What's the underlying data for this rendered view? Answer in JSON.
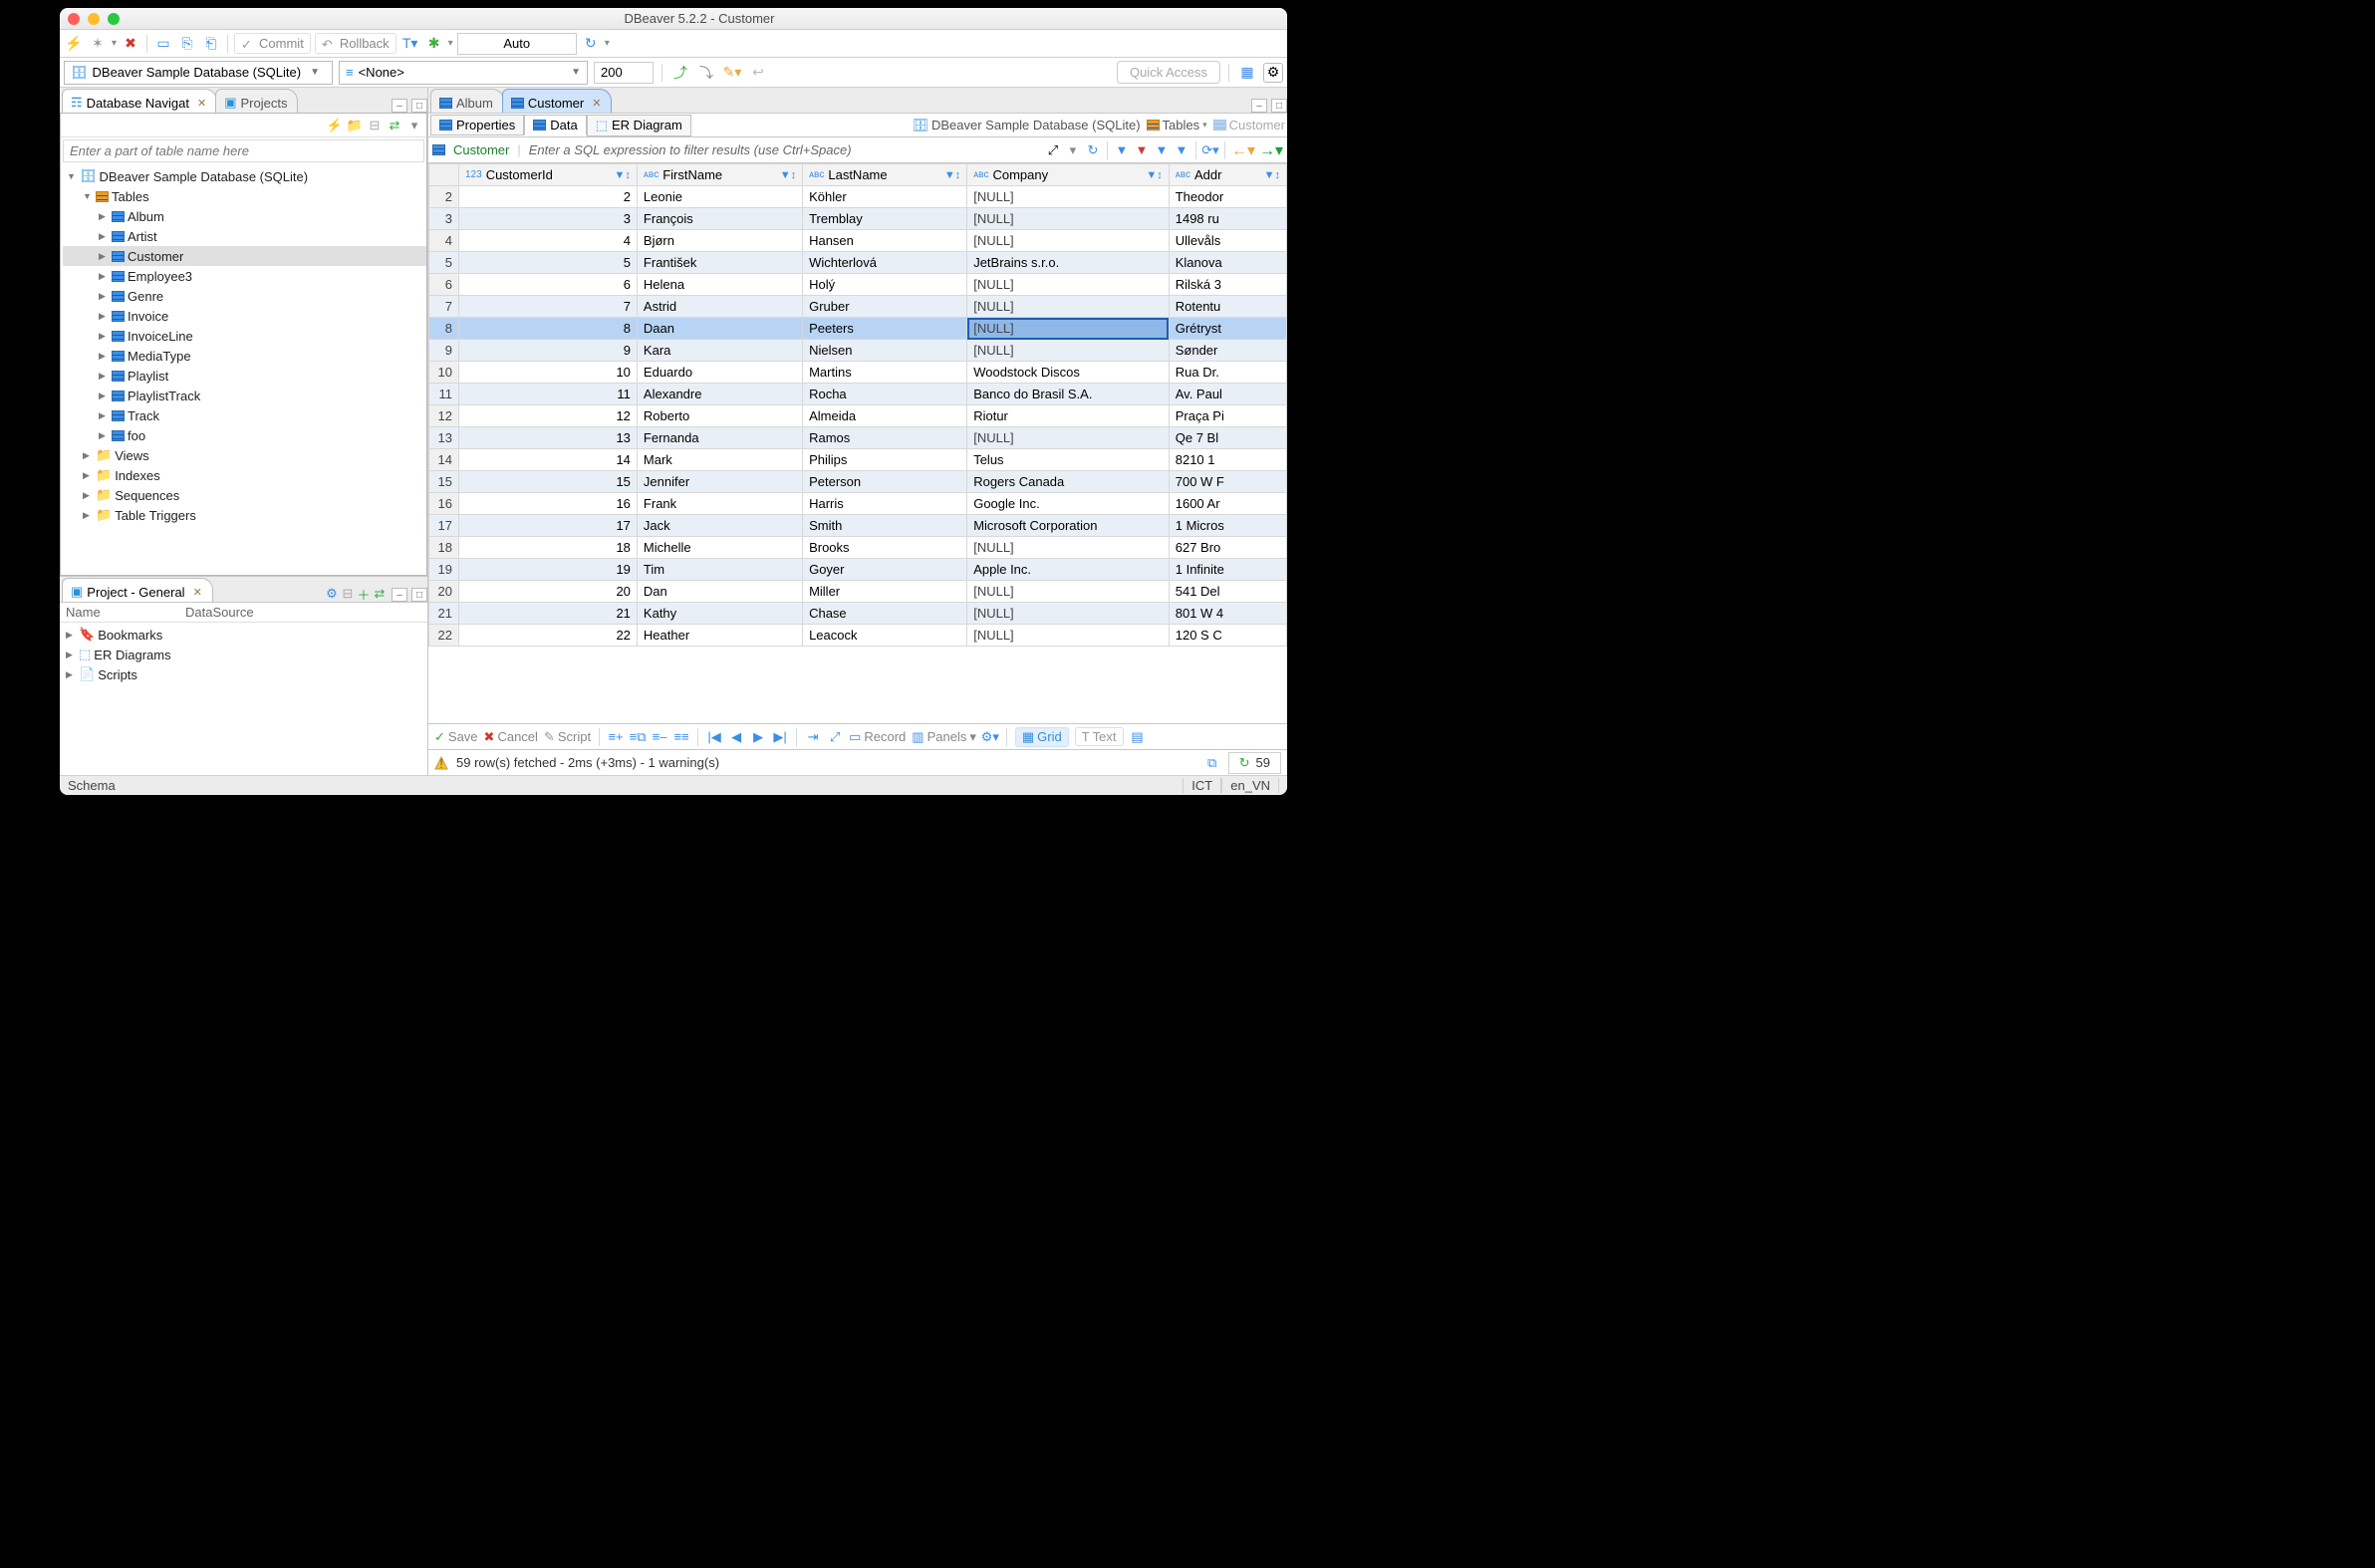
{
  "window": {
    "title": "DBeaver 5.2.2 - Customer"
  },
  "toolbar": {
    "commit": "Commit",
    "rollback": "Rollback",
    "txmode": "Auto"
  },
  "datasource": {
    "combo": "DBeaver Sample Database (SQLite)",
    "schema": "<None>",
    "limit": "200",
    "quick_access": "Quick Access"
  },
  "left": {
    "tabs": {
      "nav": "Database Navigat",
      "projects": "Projects"
    },
    "filter_placeholder": "Enter a part of table name here",
    "root": "DBeaver Sample Database (SQLite)",
    "tables_label": "Tables",
    "tables": [
      "Album",
      "Artist",
      "Customer",
      "Employee3",
      "Genre",
      "Invoice",
      "InvoiceLine",
      "MediaType",
      "Playlist",
      "PlaylistTrack",
      "Track",
      "foo"
    ],
    "folders": [
      "Views",
      "Indexes",
      "Sequences",
      "Table Triggers"
    ],
    "selected_table": "Customer"
  },
  "project": {
    "title": "Project - General",
    "cols": {
      "name": "Name",
      "ds": "DataSource"
    },
    "items": [
      "Bookmarks",
      "ER Diagrams",
      "Scripts"
    ]
  },
  "editor": {
    "tabs": {
      "album": "Album",
      "customer": "Customer"
    },
    "subtabs": {
      "props": "Properties",
      "data": "Data",
      "er": "ER Diagram"
    },
    "breadcrumb": {
      "ds": "DBeaver Sample Database (SQLite)",
      "tables": "Tables",
      "obj": "Customer"
    },
    "filter": {
      "name": "Customer",
      "prompt": "Enter a SQL expression to filter results (use Ctrl+Space)"
    },
    "columns": [
      "CustomerId",
      "FirstName",
      "LastName",
      "Company",
      "Addr"
    ],
    "selected_row": 8,
    "selected_col": 3,
    "rows": [
      {
        "n": 2,
        "id": "2",
        "first": "Leonie",
        "last": "Köhler",
        "company": "[NULL]",
        "addr": "Theodor"
      },
      {
        "n": 3,
        "id": "3",
        "first": "François",
        "last": "Tremblay",
        "company": "[NULL]",
        "addr": "1498 ru"
      },
      {
        "n": 4,
        "id": "4",
        "first": "Bjørn",
        "last": "Hansen",
        "company": "[NULL]",
        "addr": "Ullevåls"
      },
      {
        "n": 5,
        "id": "5",
        "first": "František",
        "last": "Wichterlová",
        "company": "JetBrains s.r.o.",
        "addr": "Klanova"
      },
      {
        "n": 6,
        "id": "6",
        "first": "Helena",
        "last": "Holý",
        "company": "[NULL]",
        "addr": "Rilská 3"
      },
      {
        "n": 7,
        "id": "7",
        "first": "Astrid",
        "last": "Gruber",
        "company": "[NULL]",
        "addr": "Rotentu"
      },
      {
        "n": 8,
        "id": "8",
        "first": "Daan",
        "last": "Peeters",
        "company": "[NULL]",
        "addr": "Grétryst"
      },
      {
        "n": 9,
        "id": "9",
        "first": "Kara",
        "last": "Nielsen",
        "company": "[NULL]",
        "addr": "Sønder"
      },
      {
        "n": 10,
        "id": "10",
        "first": "Eduardo",
        "last": "Martins",
        "company": "Woodstock Discos",
        "addr": "Rua Dr."
      },
      {
        "n": 11,
        "id": "11",
        "first": "Alexandre",
        "last": "Rocha",
        "company": "Banco do Brasil S.A.",
        "addr": "Av. Paul"
      },
      {
        "n": 12,
        "id": "12",
        "first": "Roberto",
        "last": "Almeida",
        "company": "Riotur",
        "addr": "Praça Pi"
      },
      {
        "n": 13,
        "id": "13",
        "first": "Fernanda",
        "last": "Ramos",
        "company": "[NULL]",
        "addr": "Qe 7 Bl"
      },
      {
        "n": 14,
        "id": "14",
        "first": "Mark",
        "last": "Philips",
        "company": "Telus",
        "addr": "8210 1"
      },
      {
        "n": 15,
        "id": "15",
        "first": "Jennifer",
        "last": "Peterson",
        "company": "Rogers Canada",
        "addr": "700 W F"
      },
      {
        "n": 16,
        "id": "16",
        "first": "Frank",
        "last": "Harris",
        "company": "Google Inc.",
        "addr": "1600 Ar"
      },
      {
        "n": 17,
        "id": "17",
        "first": "Jack",
        "last": "Smith",
        "company": "Microsoft Corporation",
        "addr": "1 Micros"
      },
      {
        "n": 18,
        "id": "18",
        "first": "Michelle",
        "last": "Brooks",
        "company": "[NULL]",
        "addr": "627 Bro"
      },
      {
        "n": 19,
        "id": "19",
        "first": "Tim",
        "last": "Goyer",
        "company": "Apple Inc.",
        "addr": "1 Infinite"
      },
      {
        "n": 20,
        "id": "20",
        "first": "Dan",
        "last": "Miller",
        "company": "[NULL]",
        "addr": "541 Del"
      },
      {
        "n": 21,
        "id": "21",
        "first": "Kathy",
        "last": "Chase",
        "company": "[NULL]",
        "addr": "801 W 4"
      },
      {
        "n": 22,
        "id": "22",
        "first": "Heather",
        "last": "Leacock",
        "company": "[NULL]",
        "addr": "120 S C"
      }
    ]
  },
  "bottombar": {
    "save": "Save",
    "cancel": "Cancel",
    "script": "Script",
    "record": "Record",
    "panels": "Panels",
    "grid": "Grid",
    "text": "Text"
  },
  "status": {
    "fetch": "59 row(s) fetched - 2ms (+3ms) - 1 warning(s)",
    "count": "59"
  },
  "footer": {
    "schema": "Schema",
    "tz": "ICT",
    "locale": "en_VN"
  }
}
